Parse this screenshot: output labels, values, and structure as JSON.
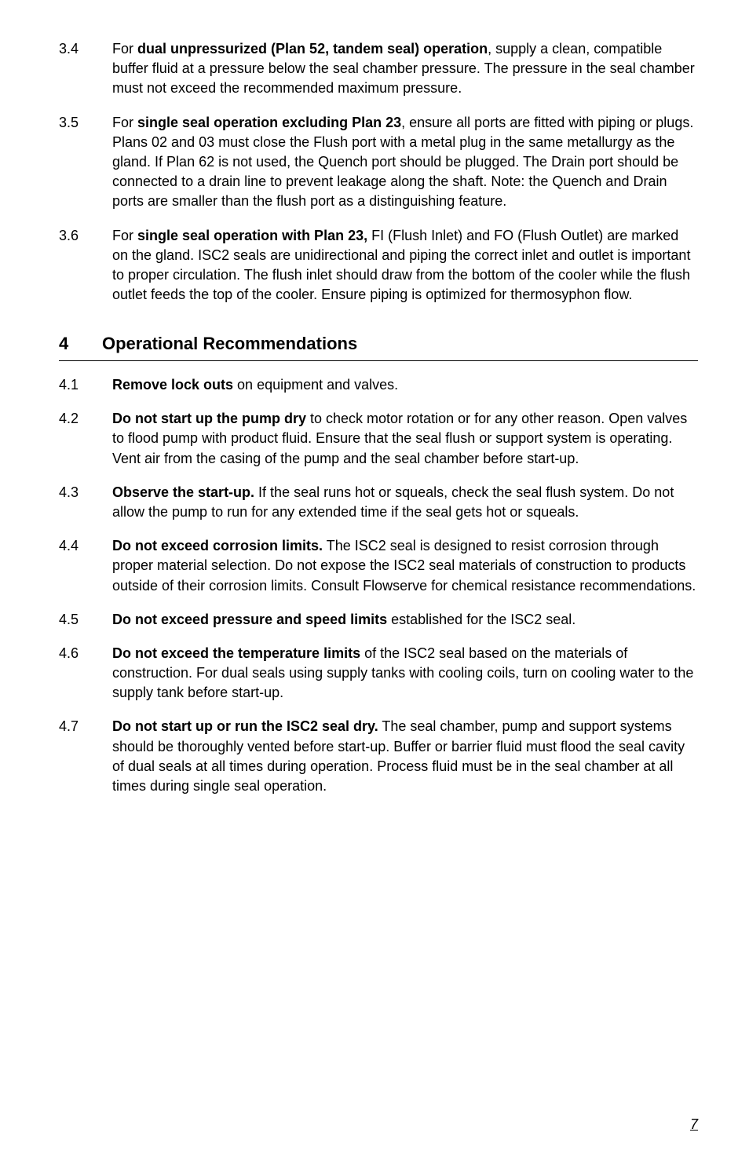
{
  "sections": {
    "piping": [
      {
        "num": "3.4",
        "html": "For <b>dual unpressurized (Plan 52, tandem seal) operation</b>, supply a clean, compatible buffer fluid at a pressure below the seal chamber pressure. The pressure in the seal chamber must not exceed the recommended maximum pressure."
      },
      {
        "num": "3.5",
        "html": "For <b>single seal operation excluding Plan 23</b>, ensure all ports are fitted with piping or plugs. Plans 02 and 03 must close the Flush port with a metal plug in the same metallurgy as the gland. If Plan 62 is not used, the Quench port should be plugged. The Drain port should be connected to a drain line to prevent leakage along the shaft. Note: the Quench and Drain ports are smaller than the flush port as a distinguishing feature."
      },
      {
        "num": "3.6",
        "html": "For <b>single seal operation with Plan 23,</b> FI (Flush Inlet) and FO (Flush Outlet) are marked on the gland. ISC2 seals are unidirectional and piping the correct inlet and outlet is important to proper circulation. The flush inlet should draw from the bottom of the cooler while the flush outlet feeds the top of the cooler. Ensure piping is optimized for thermosyphon flow."
      }
    ],
    "opsHeader": {
      "num": "4",
      "title": "Operational Recommendations"
    },
    "ops": [
      {
        "num": "4.1",
        "html": "<b>Remove lock outs</b> on equipment and valves."
      },
      {
        "num": "4.2",
        "html": "<b>Do not start up the pump dry</b> to check motor rotation or for any other reason. Open valves to flood pump with product fluid. Ensure that the seal flush or support system is operating. Vent air from the casing of the pump and the seal chamber before start-up."
      },
      {
        "num": "4.3",
        "html": "<b>Observe the start-up.</b> If the seal runs hot or squeals, check the seal flush system. Do not allow the pump to run for any extended time if the seal gets hot or squeals."
      },
      {
        "num": "4.4",
        "html": "<b>Do not exceed corrosion limits.</b> The ISC2 seal is designed to resist corrosion through proper material selection. Do not expose the ISC2 seal materials of construction to products outside of their corrosion limits. Consult Flowserve for chemical resistance recommendations."
      },
      {
        "num": "4.5",
        "html": "<b>Do not exceed pressure and speed limits</b> established for the ISC2 seal."
      },
      {
        "num": "4.6",
        "html": "<b>Do not exceed the temperature limits</b> of the ISC2 seal based on the materials of construction. For dual seals using supply tanks with cooling coils, turn on cooling water to the supply tank before start-up."
      },
      {
        "num": "4.7",
        "html": "<b>Do not start up or run the ISC2 seal dry.</b> The seal chamber, pump and support systems should be thoroughly vented before start-up. Buffer or barrier fluid must flood the seal cavity of dual seals at all times during operation. Process fluid must be in the seal chamber at all times during single seal operation."
      }
    ]
  },
  "pageNumber": "7"
}
